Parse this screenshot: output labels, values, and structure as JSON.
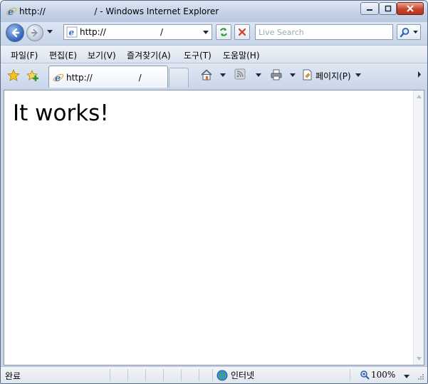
{
  "window": {
    "title": "http://                  / - Windows Internet Explorer"
  },
  "navbar": {
    "address": "http://                    /",
    "search_placeholder": "Live Search"
  },
  "menubar": {
    "items": [
      {
        "label": "파일(F)"
      },
      {
        "label": "편집(E)"
      },
      {
        "label": "보기(V)"
      },
      {
        "label": "즐겨찾기(A)"
      },
      {
        "label": "도구(T)"
      },
      {
        "label": "도움말(H)"
      }
    ]
  },
  "tabbar": {
    "active_tab_title": "http://                 /",
    "page_menu_label": "페이지(P)"
  },
  "page": {
    "heading": "It works!"
  },
  "statusbar": {
    "status": "완료",
    "zone": "인터넷",
    "zoom": "100%"
  },
  "icons": {
    "ie": "ie-logo-icon",
    "back": "back-arrow-icon",
    "forward": "forward-arrow-icon",
    "refresh": "refresh-icon",
    "stop": "stop-icon",
    "search": "magnifier-icon",
    "favorites": "star-icon",
    "add_favorite": "add-favorite-icon",
    "home": "home-icon",
    "feeds": "rss-feed-icon",
    "print": "printer-icon",
    "page": "page-icon",
    "zone": "globe-icon",
    "zoom": "zoom-icon"
  },
  "colors": {
    "chrome": "#c9d5e6",
    "close_button": "#c7452b",
    "back_button": "#2f62b8"
  }
}
